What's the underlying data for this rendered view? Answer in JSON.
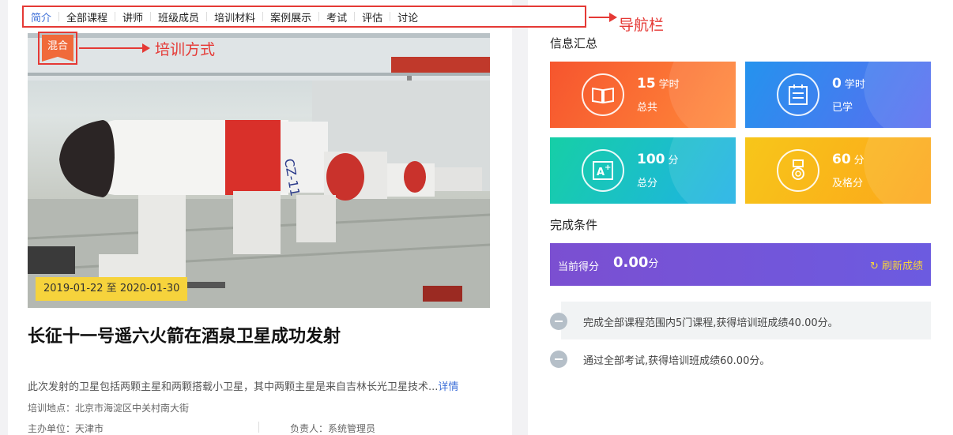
{
  "nav": {
    "items": [
      "简介",
      "全部课程",
      "讲师",
      "班级成员",
      "培训材料",
      "案例展示",
      "考试",
      "评估",
      "讨论"
    ],
    "active_index": 0,
    "annotation": "导航栏"
  },
  "course": {
    "mode_badge": "混合",
    "mode_annotation": "培训方式",
    "date_range": "2019-01-22 至 2020-01-30",
    "title": "长征十一号遥六火箭在酒泉卫星成功发射",
    "description": "此次发射的卫星包括两颗主星和两颗搭载小卫星，其中两颗主星是来自吉林长光卫星技术...",
    "more_link": "详情",
    "location": "培训地点：北京市海淀区中关村南大街",
    "organizer": "主办单位：天津市",
    "manager": "负责人：系统管理员",
    "rocket_text": "CZ-11"
  },
  "summary": {
    "title": "信息汇总",
    "cards": [
      {
        "value": "15",
        "unit": "学时",
        "label": "总共",
        "icon": "book-icon",
        "color_from": "#f6552e",
        "color_to": "#ff8a3a"
      },
      {
        "value": "0",
        "unit": "学时",
        "label": "已学",
        "icon": "notepad-icon",
        "color_from": "#2493ee",
        "color_to": "#5b6cf0"
      },
      {
        "value": "100",
        "unit": "分",
        "label": "总分",
        "icon": "grade-a-plus-icon",
        "color_from": "#16cfa6",
        "color_to": "#1fb1e6"
      },
      {
        "value": "60",
        "unit": "分",
        "label": "及格分",
        "icon": "medal-icon",
        "color_from": "#f7c61a",
        "color_to": "#fca61b"
      }
    ]
  },
  "completion": {
    "title": "完成条件",
    "score_label": "当前得分",
    "score_value": "0.00",
    "score_unit": "分",
    "refresh_label": "刷新成绩",
    "conditions": [
      "完成全部课程范围内5门课程,获得培训班成绩40.00分。",
      "通过全部考试,获得培训班成绩60.00分。"
    ]
  }
}
